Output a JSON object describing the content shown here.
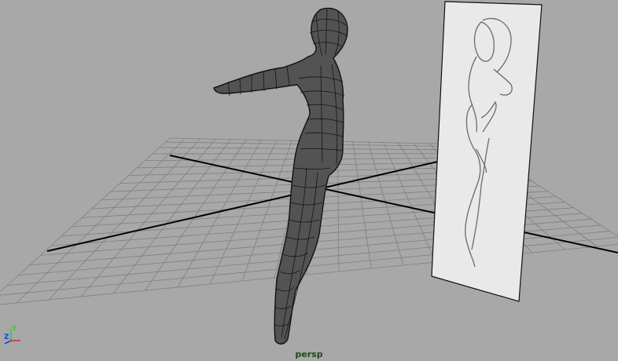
{
  "viewport": {
    "camera_name": "persp",
    "background_color": "#a8a8a8",
    "grid_color": "#7f7f7f",
    "grid_axis_color": "#000000"
  },
  "axis_gizmo": {
    "y_label": "Y",
    "z_label": "Z",
    "x_color": "#d23333",
    "y_color": "#33cc33",
    "z_color": "#2a3ad6"
  },
  "objects": {
    "character_mesh": "polygon-character",
    "reference_plane": "image-plane-sketch"
  }
}
